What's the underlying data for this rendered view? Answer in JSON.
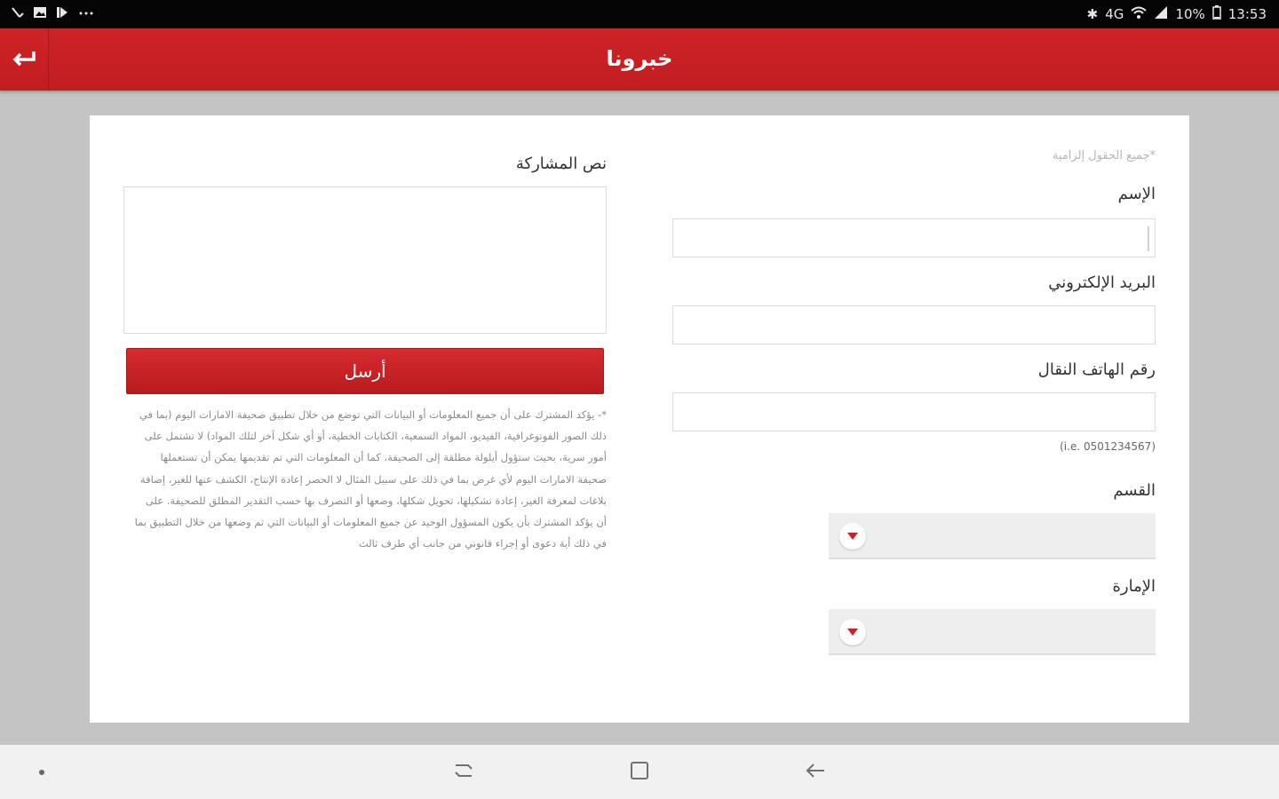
{
  "status_bar": {
    "right": {
      "bluetooth": "✱",
      "signal_text": "4G",
      "battery": "10%",
      "time": "13:53"
    },
    "left_icons": [
      "missed-call-icon",
      "image-icon",
      "media-icon",
      "more-icon"
    ]
  },
  "header": {
    "title": "خبرونا",
    "background": "#c9202a"
  },
  "form": {
    "required_note": "*جميع الحقول إلزامية",
    "name_label": "الإسم",
    "email_label": "البريد الإلكتروني",
    "phone_label": "رقم الهاتف النقال",
    "phone_hint": "(i.e. 0501234567)",
    "section_label": "القسم",
    "emirate_label": "الإمارة",
    "message_label": "نص المشاركة",
    "submit_label": "أرسل",
    "disclaimer": "*- يؤكد المشترك على أن جميع المعلومات أو البيانات التي توضع من خلال تطبيق صحيفة الامارات اليوم (بما في ذلك الصور الفوتوغرافية، الفيديو، المواد السمعية، الكتابات الخطية، أو أي شكل آخر لتلك المواد) لا تشتمل على أمور سرية، بحيث ستؤول أيلولة مطلقة إلى الصحيفة، كما أن المعلومات التي تم تقديمها يمكن أن تستعملها صحيفة الامارات اليوم لأي غرض بما في ذلك على سبيل المثال لا الحصر إعادة الإنتاج، الكشف عنها للغير، إضافة بلاغات لمعرفة الغير، إعادة تشكيلها، تحويل شكلها، وضعها أو التصرف بها حسب التقدير المطلق للصحيفة. على أن يؤكد المشترك بأن يكون المسؤول الوحيد عن جميع المعلومات أو البيانات التي تم وضعها من خلال التطبيق بما في ذلك أية دعوى أو إجراء قانوني من جانب أي طرف ثالث"
  },
  "colors": {
    "accent": "#c9202a",
    "page_bg": "#c4c4c4"
  }
}
